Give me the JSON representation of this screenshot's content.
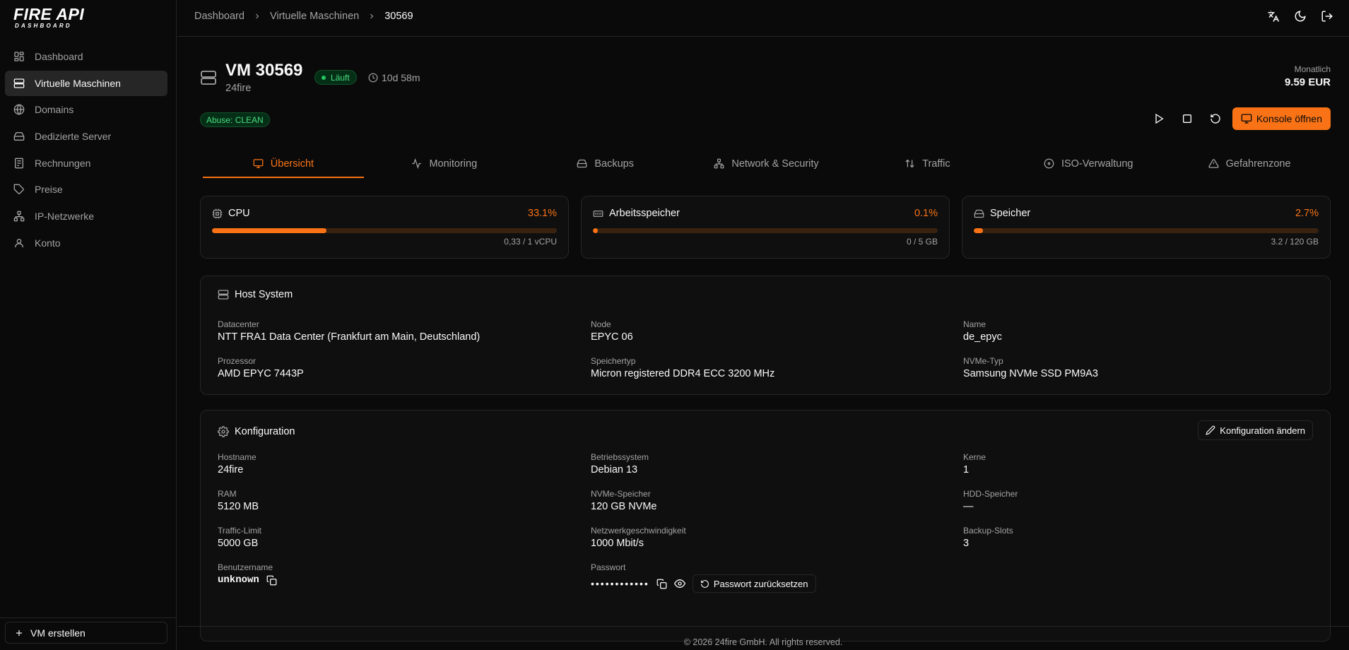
{
  "brand": {
    "name": "FIRE API",
    "sub": "DASHBOARD"
  },
  "sidebar": {
    "items": [
      {
        "label": "Dashboard",
        "icon": "dashboard-icon"
      },
      {
        "label": "Virtuelle Maschinen",
        "icon": "server-icon"
      },
      {
        "label": "Domains",
        "icon": "globe-icon"
      },
      {
        "label": "Dedizierte Server",
        "icon": "hard-drive-icon"
      },
      {
        "label": "Rechnungen",
        "icon": "receipt-icon"
      },
      {
        "label": "Preise",
        "icon": "tag-icon"
      },
      {
        "label": "IP-Netzwerke",
        "icon": "network-icon"
      },
      {
        "label": "Konto",
        "icon": "user-icon"
      }
    ],
    "create_label": "VM erstellen"
  },
  "header": {
    "breadcrumbs": [
      "Dashboard",
      "Virtuelle Maschinen",
      "30569"
    ]
  },
  "vm": {
    "title": "VM 30569",
    "hostname_sub": "24fire",
    "status": "Läuft",
    "uptime": "10d 58m",
    "price_label": "Monatlich",
    "price_value": "9.59 EUR",
    "abuse": "Abuse: CLEAN",
    "console_label": "Konsole öffnen"
  },
  "tabs": [
    {
      "label": "Übersicht",
      "icon": "monitor-icon"
    },
    {
      "label": "Monitoring",
      "icon": "activity-icon"
    },
    {
      "label": "Backups",
      "icon": "hard-drive-icon"
    },
    {
      "label": "Network & Security",
      "icon": "network-icon"
    },
    {
      "label": "Traffic",
      "icon": "arrows-updown-icon"
    },
    {
      "label": "ISO-Verwaltung",
      "icon": "disc-icon"
    },
    {
      "label": "Gefahrenzone",
      "icon": "warning-icon"
    }
  ],
  "stats": [
    {
      "label": "CPU",
      "percent": "33.1%",
      "fraction": 0.331,
      "detail": "0,33 / 1 vCPU",
      "icon": "cpu-icon"
    },
    {
      "label": "Arbeitsspeicher",
      "percent": "0.1%",
      "fraction": 0.001,
      "detail": "0 / 5 GB",
      "icon": "memory-icon"
    },
    {
      "label": "Speicher",
      "percent": "2.7%",
      "fraction": 0.027,
      "detail": "3.2 / 120 GB",
      "icon": "hard-drive-icon"
    }
  ],
  "host": {
    "title": "Host System",
    "fields": [
      {
        "label": "Datacenter",
        "value": "NTT FRA1 Data Center (Frankfurt am Main, Deutschland)"
      },
      {
        "label": "Node",
        "value": "EPYC 06"
      },
      {
        "label": "Name",
        "value": "de_epyc"
      },
      {
        "label": "Prozessor",
        "value": "AMD EPYC 7443P"
      },
      {
        "label": "Speichertyp",
        "value": "Micron registered DDR4 ECC 3200 MHz"
      },
      {
        "label": "NVMe-Typ",
        "value": "Samsung NVMe SSD PM9A3"
      }
    ]
  },
  "config": {
    "title": "Konfiguration",
    "edit_label": "Konfiguration ändern",
    "fields": [
      {
        "label": "Hostname",
        "value": "24fire"
      },
      {
        "label": "Betriebssystem",
        "value": "Debian 13"
      },
      {
        "label": "Kerne",
        "value": "1"
      },
      {
        "label": "RAM",
        "value": "5120 MB"
      },
      {
        "label": "NVMe-Speicher",
        "value": "120 GB NVMe"
      },
      {
        "label": "HDD-Speicher",
        "value": "—"
      },
      {
        "label": "Traffic-Limit",
        "value": "5000 GB"
      },
      {
        "label": "Netzwerkgeschwindigkeit",
        "value": "1000 Mbit/s"
      },
      {
        "label": "Backup-Slots",
        "value": "3"
      }
    ],
    "username_label": "Benutzername",
    "username_value": "unknown",
    "password_label": "Passwort",
    "password_value": "••••••••••••",
    "reset_label": "Passwort zurücksetzen"
  },
  "footer": {
    "text": "© 2026 24fire GmbH. All rights reserved."
  }
}
